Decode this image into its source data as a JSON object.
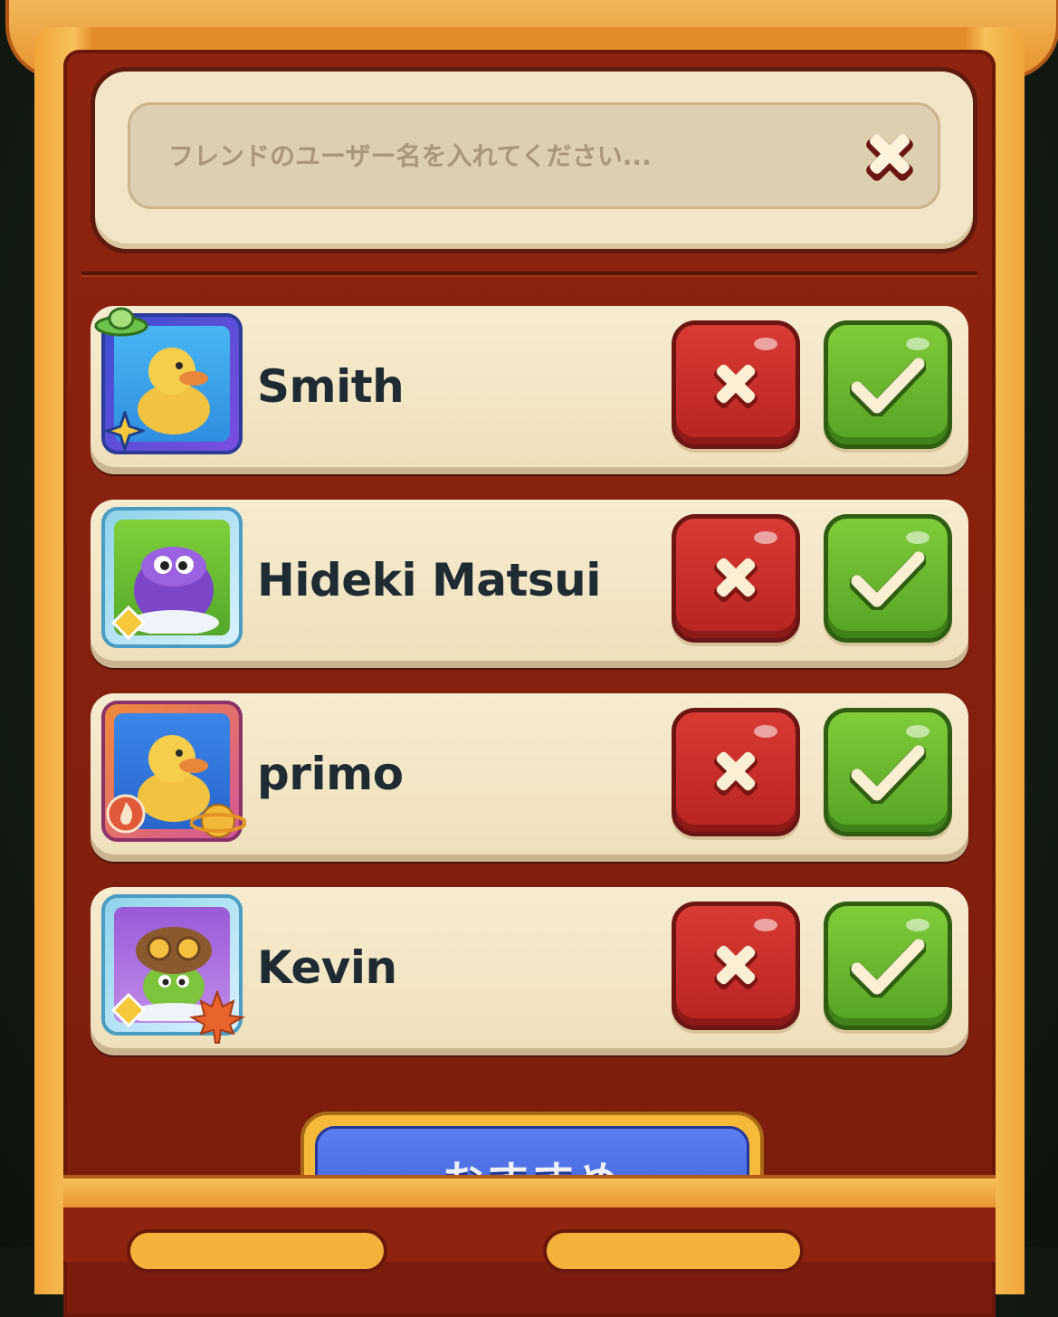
{
  "search": {
    "placeholder": "フレンドのユーザー名を入れてください..."
  },
  "requests": [
    {
      "name": "Smith"
    },
    {
      "name": "Hideki Matsui"
    },
    {
      "name": "primo"
    },
    {
      "name": "Kevin"
    }
  ],
  "recommend_button": {
    "label": "おすすめ"
  },
  "colors": {
    "decline": "#c62c27",
    "accept": "#6bb82f",
    "panel": "#8e2410",
    "card": "#f3e6c6",
    "name_text": "#1e2b33"
  }
}
